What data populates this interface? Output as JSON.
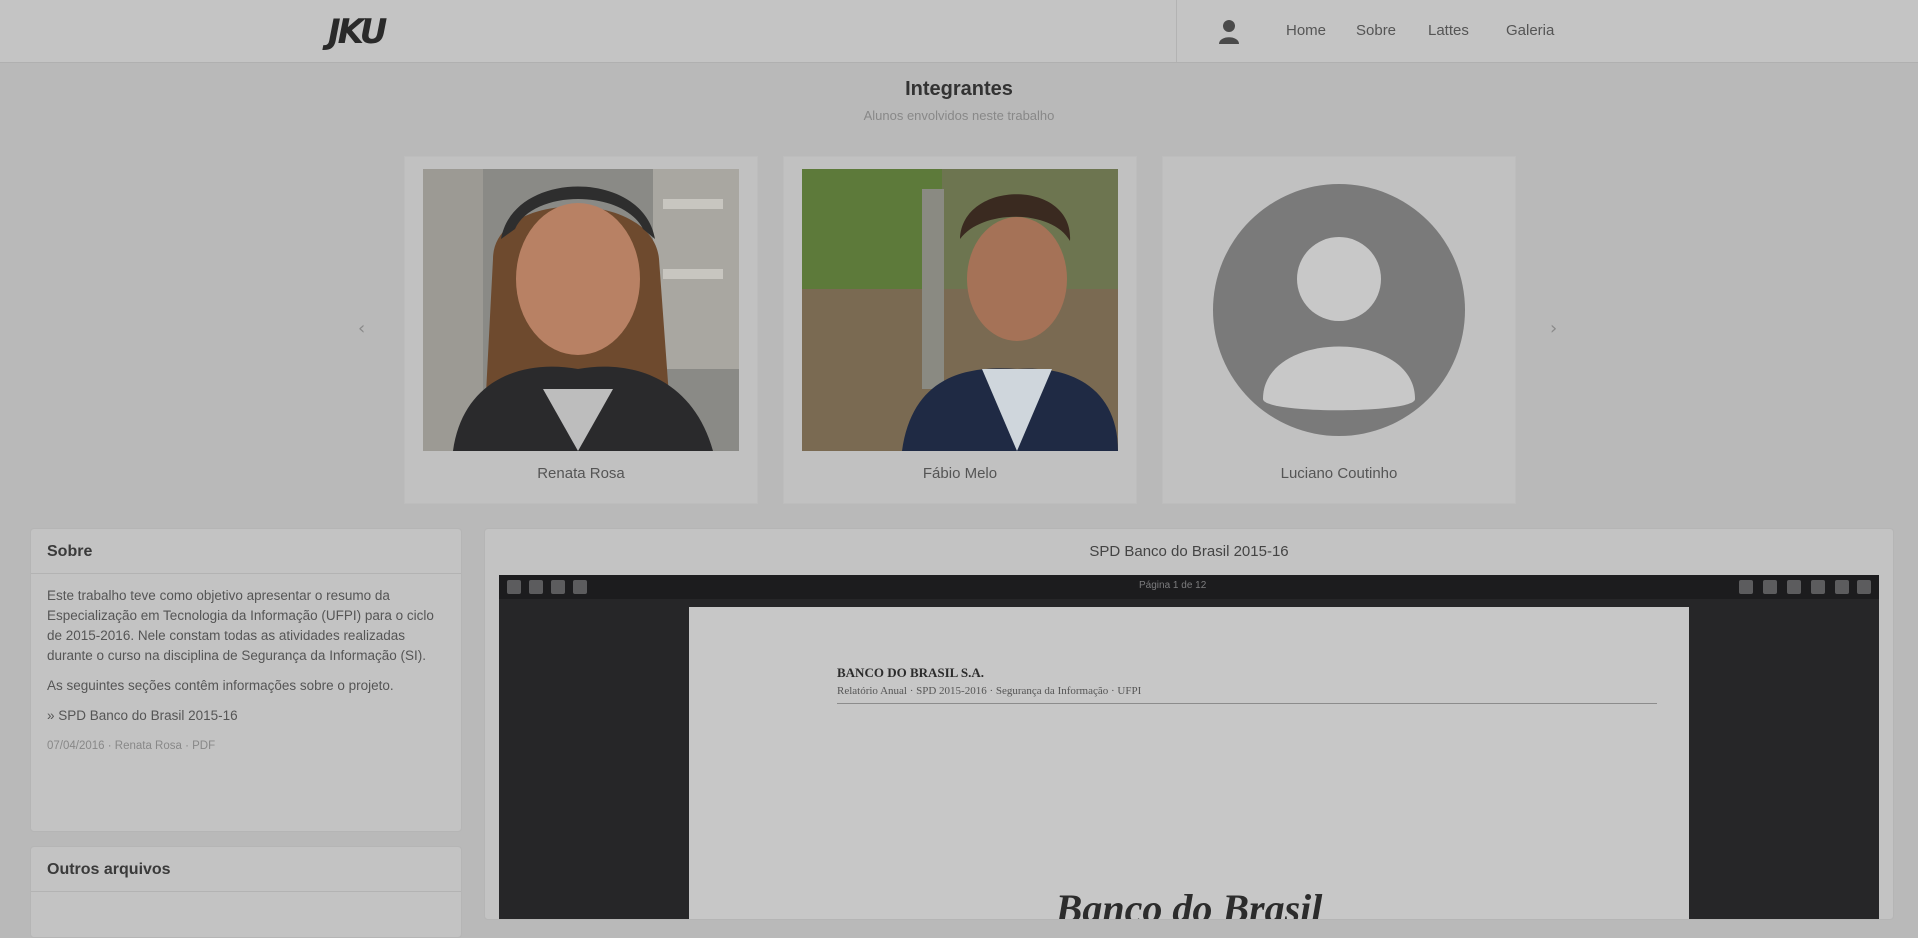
{
  "header": {
    "logo": "JKU",
    "nav": [
      "Home",
      "Sobre",
      "Lattes",
      "Galeria"
    ]
  },
  "team": {
    "title": "Integrantes",
    "subtitle": "Alunos envolvidos neste trabalho",
    "members": [
      {
        "name": "Renata Rosa",
        "photo": "woman-portrait"
      },
      {
        "name": "Fábio Melo",
        "photo": "man-portrait"
      },
      {
        "name": "Luciano Coutinho",
        "photo": "default-avatar"
      }
    ]
  },
  "sidebar": {
    "about": {
      "title": "Sobre",
      "paragraph1": "Este trabalho teve como objetivo apresentar o resumo da Especialização em Tecnologia da Informação (UFPI) para o ciclo de 2015-2016. Nele constam todas as atividades realizadas durante o curso na disciplina de Segurança da Informação (SI).",
      "paragraph2": "As seguintes seções contêm informações sobre o projeto.",
      "link": "» SPD Banco do Brasil 2015-16",
      "meta": "07/04/2016 · Renata Rosa · PDF"
    },
    "related": {
      "title": "Outros arquivos"
    }
  },
  "main": {
    "title": "SPD Banco do Brasil 2015-16",
    "viewer": {
      "toolbar_label": "Página 1 de 12",
      "doc_heading": "BANCO DO BRASIL S.A.",
      "doc_subheading": "Relatório Anual · SPD 2015-2016 · Segurança da Informação · UFPI",
      "doc_title": "Banco do Brasil"
    }
  }
}
